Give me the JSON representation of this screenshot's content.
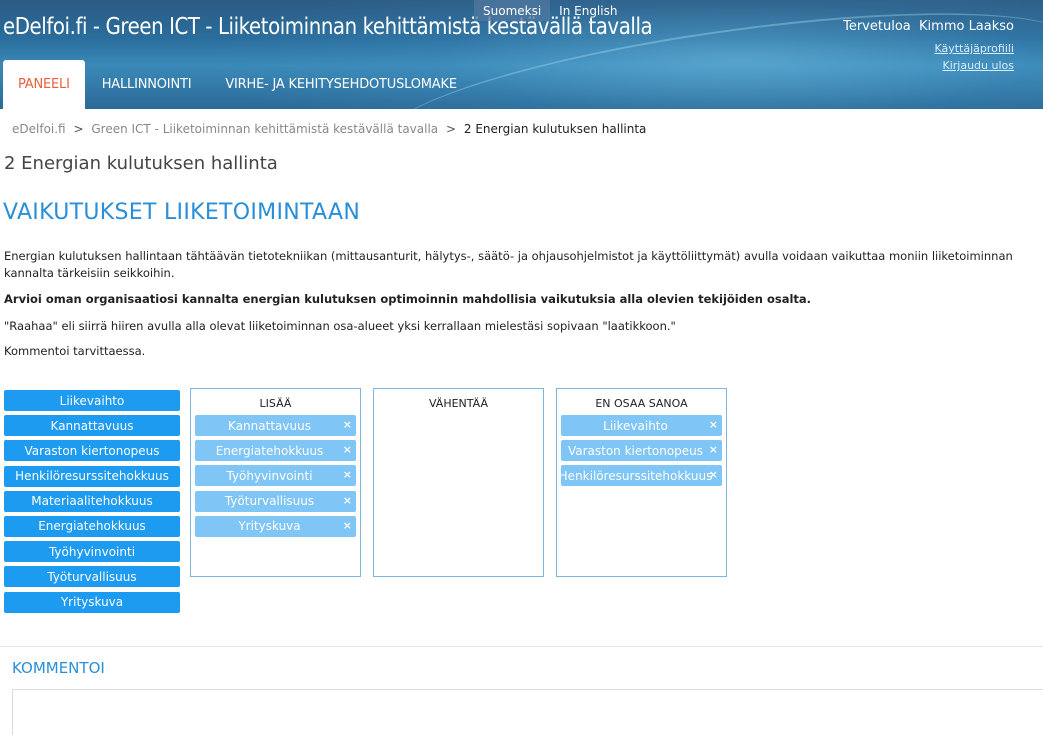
{
  "header": {
    "site_title": "eDelfoi.fi - Green ICT - Liiketoiminnan kehittämistä kestävällä tavalla",
    "languages": [
      "Suomeksi",
      "In English"
    ],
    "welcome": "Tervetuloa",
    "user_name": "Kimmo Laakso",
    "profile_link": "Käyttäjäprofiili",
    "logout_link": "Kirjaudu ulos",
    "nav": [
      "PANEELI",
      "HALLINNOINTI",
      "VIRHE- JA KEHITYSEHDOTUSLOMAKE"
    ]
  },
  "breadcrumb": {
    "items": [
      "eDelfoi.fi",
      "Green ICT - Liiketoiminnan kehittämistä kestävällä tavalla",
      "2 Energian kulutuksen hallinta"
    ],
    "separator": ">"
  },
  "page_title": "2 Energian kulutuksen hallinta",
  "section_title": "VAIKUTUKSET LIIKETOIMINTAAN",
  "texts": {
    "intro": "Energian kulutuksen hallintaan tähtäävän tietotekniikan (mittausanturit, hälytys-, säätö- ja ohjausohjelmistot ja käyttöliittymät) avulla voidaan vaikuttaa moniin liiketoiminnan kannalta tärkeisiin seikkoihin.",
    "instruction_bold": "Arvioi oman organisaatiosi kannalta energian kulutuksen optimoinnin mahdollisia vaikutuksia alla olevien tekijöiden osalta.",
    "drag_hint": "\"Raahaa\" eli siirrä hiiren avulla alla olevat liiketoiminnan osa-alueet yksi kerrallaan mielestäsi sopivaan \"laatikkoon.\"",
    "comment_hint": "Kommentoi tarvittaessa."
  },
  "source_items": [
    "Liikevaihto",
    "Kannattavuus",
    "Varaston kiertonopeus",
    "Henkilöresurssitehokkuus",
    "Materiaalitehokkuus",
    "Energiatehokkuus",
    "Työhyvinvointi",
    "Työturvallisuus",
    "Yrityskuva"
  ],
  "boxes": [
    {
      "title": "LISÄÄ",
      "items": [
        "Kannattavuus",
        "Energiatehokkuus",
        "Työhyvinvointi",
        "Työturvallisuus",
        "Yrityskuva"
      ]
    },
    {
      "title": "VÄHENTÄÄ",
      "items": []
    },
    {
      "title": "EN OSAA SANOA",
      "items": [
        "Liikevaihto",
        "Varaston kiertonopeus",
        "Henkilöresurssitehokkuus"
      ]
    }
  ],
  "remove_glyph": "×",
  "comment": {
    "title": "KOMMENTOI"
  },
  "colors": {
    "accent": "#2a8fd8",
    "tag": "#1d9bf0",
    "tag_placed": "#7fc5f5",
    "nav_active": "#e8603a"
  }
}
